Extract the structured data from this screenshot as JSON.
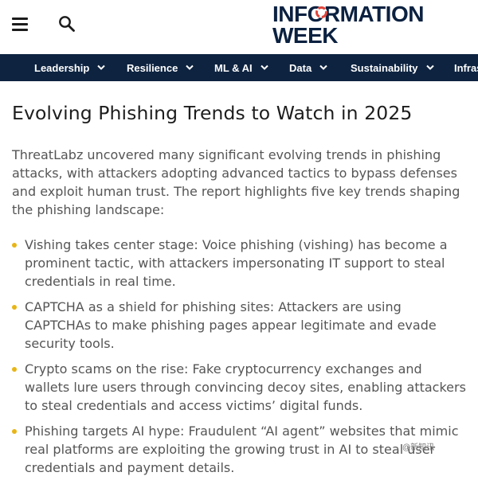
{
  "header": {
    "logo_line1": "INFORMATION",
    "logo_line2": "WEEK",
    "menu_icon": "hamburger-menu-icon",
    "search_icon": "search-icon",
    "logo_color": "#0b2140",
    "logo_accent": "#e0453b"
  },
  "nav": {
    "background": "#0d2340",
    "items": [
      {
        "label": "Leadership"
      },
      {
        "label": "Resilience"
      },
      {
        "label": "ML & AI"
      },
      {
        "label": "Data"
      },
      {
        "label": "Sustainability"
      },
      {
        "label": "Infras"
      }
    ]
  },
  "article": {
    "title": "Evolving Phishing Trends to Watch in 2025",
    "intro": "ThreatLabz uncovered many significant evolving trends in phishing attacks, with attackers adopting advanced tactics to bypass defenses and exploit human trust. The report highlights five key trends shaping the phishing landscape:",
    "bullets": [
      "Vishing takes center stage: Voice phishing (vishing) has become a prominent tactic, with attackers impersonating IT support to steal credentials in real time.",
      "CAPTCHA as a shield for phishing sites: Attackers are using CAPTCHAs to make phishing pages appear legitimate and evade security tools.",
      "Crypto scams on the rise: Fake cryptocurrency exchanges and wallets lure users through convincing decoy sites, enabling attackers to steal credentials and access victims’ digital funds.",
      "Phishing targets AI hype: Fraudulent “AI agent” websites that mimic real platforms are exploiting the growing trust in AI to steal user credentials and payment details."
    ],
    "bullet_color": "#e7b517"
  },
  "watermark": "@新知讯"
}
